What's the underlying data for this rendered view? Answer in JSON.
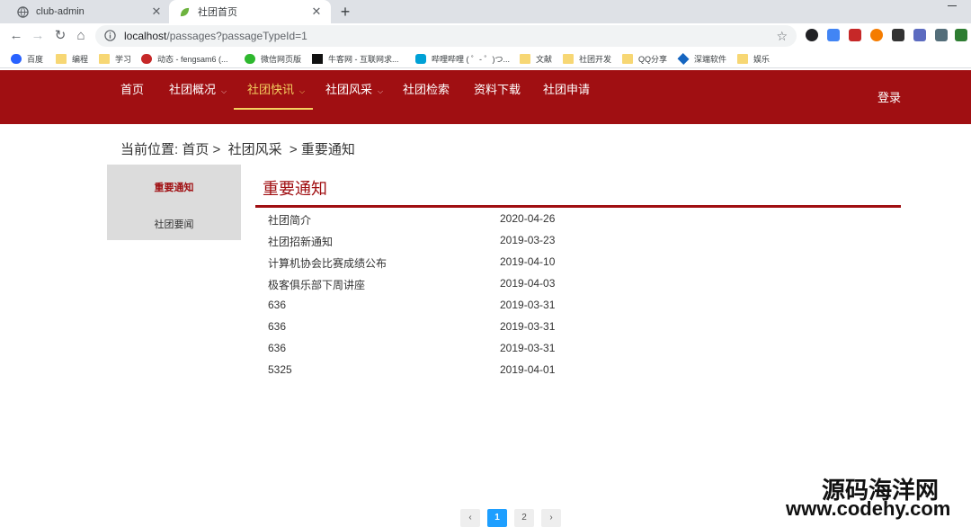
{
  "browser": {
    "tabs": [
      {
        "title": "club-admin",
        "icon": "globe-icon"
      },
      {
        "title": "社团首页",
        "icon": "leaf-icon"
      }
    ],
    "close_glyph": "✕",
    "newtab_glyph": "+",
    "back_glyph": "←",
    "forward_glyph": "→",
    "reload_glyph": "↻",
    "home_glyph": "⌂",
    "star_glyph": "☆",
    "url_host": "localhost",
    "url_rest": "/passages?passageTypeId=1",
    "bookmarks": [
      "百度",
      "编程",
      "学习",
      "动态 - fengsam6 (...",
      "微信网页版",
      "牛客网 - 互联网求...",
      "哔哩哔哩 ( ゜- ゜)つ...",
      "文献",
      "社团开发",
      "QQ分享",
      "深端软件",
      "娱乐"
    ]
  },
  "site": {
    "brand_color": "#a00f12",
    "accent_color": "#f4d060",
    "nav": [
      {
        "label": "首页",
        "dropdown": false
      },
      {
        "label": "社团概况",
        "dropdown": true
      },
      {
        "label": "社团快讯",
        "dropdown": true,
        "active": true
      },
      {
        "label": "社团风采",
        "dropdown": true
      },
      {
        "label": "社团检索",
        "dropdown": false
      },
      {
        "label": "资料下载",
        "dropdown": false
      },
      {
        "label": "社团申请",
        "dropdown": false
      }
    ],
    "caret": "⌵",
    "login": "登录"
  },
  "breadcrumb": "当前位置: 首页 >  社团风采  > 重要通知",
  "side_menu": {
    "active": "重要通知",
    "other": "社团要闻"
  },
  "section_title": "重要通知",
  "notices": [
    {
      "title": "社团简介",
      "date": "2020-04-26"
    },
    {
      "title": "社团招新通知",
      "date": "2019-03-23"
    },
    {
      "title": "计算机协会比赛成绩公布",
      "date": "2019-04-10"
    },
    {
      "title": "极客俱乐部下周讲座",
      "date": "2019-04-03"
    },
    {
      "title": "636",
      "date": "2019-03-31"
    },
    {
      "title": "636",
      "date": "2019-03-31"
    },
    {
      "title": "636",
      "date": "2019-03-31"
    },
    {
      "title": "5325",
      "date": "2019-04-01"
    }
  ],
  "pager": {
    "prev": "‹",
    "pages": [
      "1",
      "2"
    ],
    "current": "1",
    "next": "›"
  },
  "watermark": {
    "line1": "源码海洋网",
    "line2": "www.codehy.com"
  }
}
